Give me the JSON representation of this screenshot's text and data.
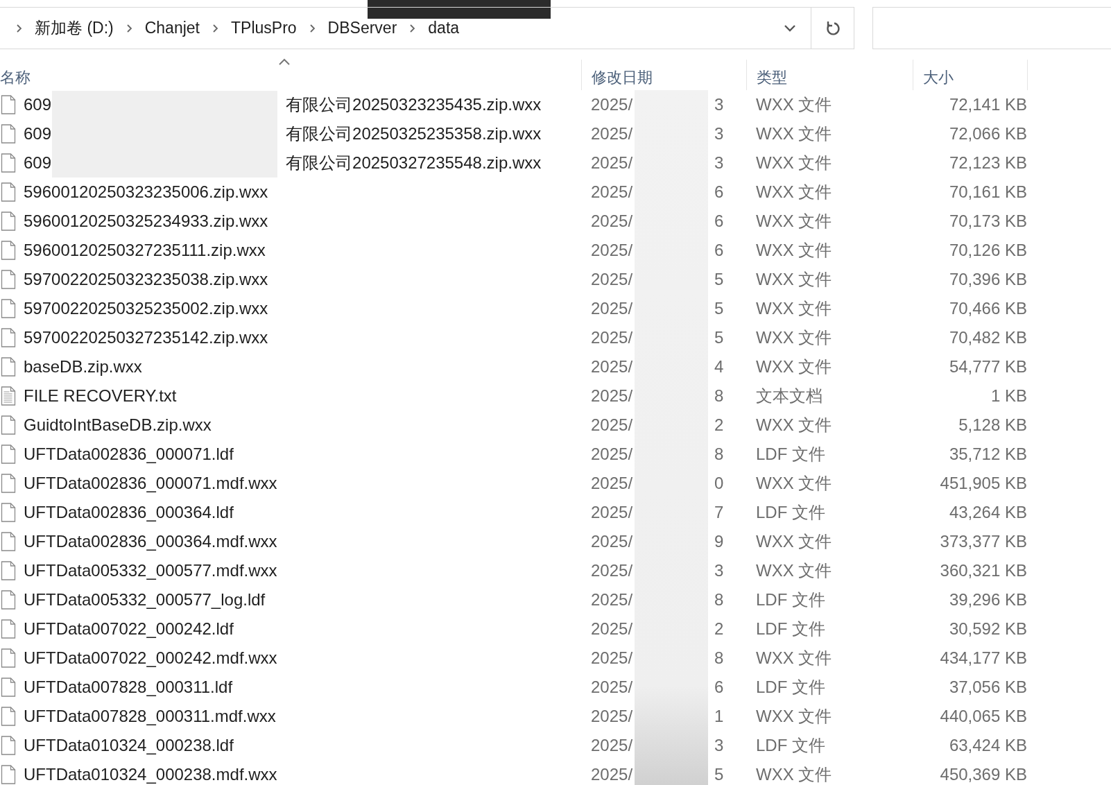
{
  "address_bar": {
    "breadcrumbs": [
      "新加卷 (D:)",
      "Chanjet",
      "TPlusPro",
      "DBServer",
      "data"
    ]
  },
  "columns": [
    {
      "label": "名称",
      "sorted": true
    },
    {
      "label": "修改日期",
      "sorted": false
    },
    {
      "label": "类型",
      "sorted": false
    },
    {
      "label": "大小",
      "sorted": false
    }
  ],
  "files": [
    {
      "kind": "blank",
      "name_start": "609",
      "name_end": "有限公司20250323235435.zip.wxx",
      "date_start": "2025/",
      "date_end": "3",
      "type": "WXX 文件",
      "size": "72,141 KB"
    },
    {
      "kind": "blank",
      "name_start": "609",
      "name_end": "有限公司20250325235358.zip.wxx",
      "date_start": "2025/",
      "date_end": "3",
      "type": "WXX 文件",
      "size": "72,066 KB"
    },
    {
      "kind": "blank",
      "name_start": "609",
      "name_end": "有限公司20250327235548.zip.wxx",
      "date_start": "2025/",
      "date_end": "3",
      "type": "WXX 文件",
      "size": "72,123 KB"
    },
    {
      "kind": "blank",
      "name_start": "59600120250323235006.zip.wxx",
      "date_start": "2025/",
      "date_end": "6",
      "type": "WXX 文件",
      "size": "70,161 KB"
    },
    {
      "kind": "blank",
      "name_start": "59600120250325234933.zip.wxx",
      "date_start": "2025/",
      "date_end": "6",
      "type": "WXX 文件",
      "size": "70,173 KB"
    },
    {
      "kind": "blank",
      "name_start": "59600120250327235111.zip.wxx",
      "date_start": "2025/",
      "date_end": "6",
      "type": "WXX 文件",
      "size": "70,126 KB"
    },
    {
      "kind": "blank",
      "name_start": "59700220250323235038.zip.wxx",
      "date_start": "2025/",
      "date_end": "5",
      "type": "WXX 文件",
      "size": "70,396 KB"
    },
    {
      "kind": "blank",
      "name_start": "59700220250325235002.zip.wxx",
      "date_start": "2025/",
      "date_end": "5",
      "type": "WXX 文件",
      "size": "70,466 KB"
    },
    {
      "kind": "blank",
      "name_start": "59700220250327235142.zip.wxx",
      "date_start": "2025/",
      "date_end": "5",
      "type": "WXX 文件",
      "size": "70,482 KB"
    },
    {
      "kind": "blank",
      "name_start": "baseDB.zip.wxx",
      "date_start": "2025/",
      "date_end": "4",
      "type": "WXX 文件",
      "size": "54,777 KB"
    },
    {
      "kind": "text",
      "name_start": "FILE RECOVERY.txt",
      "date_start": "2025/",
      "date_end": "8",
      "type": "文本文档",
      "size": "1 KB"
    },
    {
      "kind": "blank",
      "name_start": "GuidtoIntBaseDB.zip.wxx",
      "date_start": "2025/",
      "date_end": "2",
      "type": "WXX 文件",
      "size": "5,128 KB"
    },
    {
      "kind": "blank",
      "name_start": "UFTData002836_000071.ldf",
      "date_start": "2025/",
      "date_end": "8",
      "type": "LDF 文件",
      "size": "35,712 KB"
    },
    {
      "kind": "blank",
      "name_start": "UFTData002836_000071.mdf.wxx",
      "date_start": "2025/",
      "date_end": "0",
      "type": "WXX 文件",
      "size": "451,905 KB"
    },
    {
      "kind": "blank",
      "name_start": "UFTData002836_000364.ldf",
      "date_start": "2025/",
      "date_end": "7",
      "type": "LDF 文件",
      "size": "43,264 KB"
    },
    {
      "kind": "blank",
      "name_start": "UFTData002836_000364.mdf.wxx",
      "date_start": "2025/",
      "date_end": "9",
      "type": "WXX 文件",
      "size": "373,377 KB"
    },
    {
      "kind": "blank",
      "name_start": "UFTData005332_000577.mdf.wxx",
      "date_start": "2025/",
      "date_end": "3",
      "type": "WXX 文件",
      "size": "360,321 KB"
    },
    {
      "kind": "blank",
      "name_start": "UFTData005332_000577_log.ldf",
      "date_start": "2025/",
      "date_end": "8",
      "type": "LDF 文件",
      "size": "39,296 KB"
    },
    {
      "kind": "blank",
      "name_start": "UFTData007022_000242.ldf",
      "date_start": "2025/",
      "date_end": "2",
      "type": "LDF 文件",
      "size": "30,592 KB"
    },
    {
      "kind": "blank",
      "name_start": "UFTData007022_000242.mdf.wxx",
      "date_start": "2025/",
      "date_end": "8",
      "type": "WXX 文件",
      "size": "434,177 KB"
    },
    {
      "kind": "blank",
      "name_start": "UFTData007828_000311.ldf",
      "date_start": "2025/",
      "date_end": "6",
      "type": "LDF 文件",
      "size": "37,056 KB"
    },
    {
      "kind": "blank",
      "name_start": "UFTData007828_000311.mdf.wxx",
      "date_start": "2025/",
      "date_end": "1",
      "type": "WXX 文件",
      "size": "440,065 KB"
    },
    {
      "kind": "blank",
      "name_start": "UFTData010324_000238.ldf",
      "date_start": "2025/",
      "date_end": "3",
      "type": "LDF 文件",
      "size": "63,424 KB"
    },
    {
      "kind": "blank",
      "name_start": "UFTData010324_000238.mdf.wxx",
      "date_start": "2025/",
      "date_end": "5",
      "type": "WXX 文件",
      "size": "450,369 KB"
    }
  ]
}
